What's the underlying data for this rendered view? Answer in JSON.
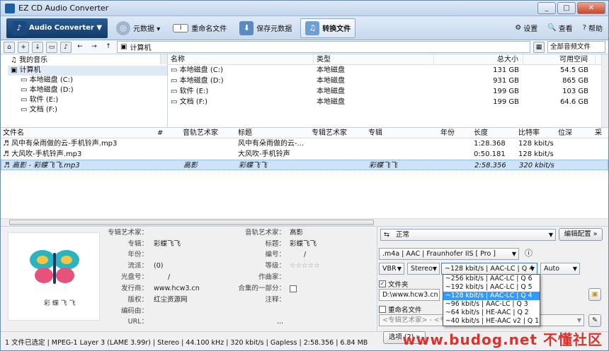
{
  "window": {
    "title": "EZ CD Audio Converter"
  },
  "ribbon": {
    "primary": "Audio Converter ▼",
    "metadata": "元数据 ▾",
    "rename": "重命名文件",
    "save_meta": "保存元数据",
    "convert": "转换文件",
    "settings": "设置",
    "view": "查看",
    "help": "帮助"
  },
  "nav": {
    "address": "计算机",
    "filter": "全部音频文件"
  },
  "tree": [
    "我的音乐",
    "计算机",
    "本地磁盘 (C:)",
    "本地磁盘 (D:)",
    "软件 (E:)",
    "文档 (F:)"
  ],
  "drives": {
    "headers": [
      "名称",
      "类型",
      "总大小",
      "可用空间"
    ],
    "rows": [
      {
        "name": "本地磁盘 (C:)",
        "type": "本地磁盘",
        "total": "131 GB",
        "free": "54.5 GB"
      },
      {
        "name": "本地磁盘 (D:)",
        "type": "本地磁盘",
        "total": "931 GB",
        "free": "865 GB"
      },
      {
        "name": "软件 (E:)",
        "type": "本地磁盘",
        "total": "199 GB",
        "free": "103 GB"
      },
      {
        "name": "文档 (F:)",
        "type": "本地磁盘",
        "total": "199 GB",
        "free": "64.6 GB"
      }
    ]
  },
  "tracks": {
    "headers": [
      "文件名",
      "#",
      "音轨艺术家",
      "标题",
      "专辑艺术家",
      "专辑",
      "年份",
      "长度",
      "比特率",
      "位深",
      "采"
    ],
    "rows": [
      {
        "file": "风中有朵雨做的云-手机铃声.mp3",
        "artist": "",
        "title": "风中有朵雨做的云-...",
        "album": "",
        "len": "1:28.368",
        "bitrate": "128 kbit/s"
      },
      {
        "file": "大风吹-手机铃声.mp3",
        "artist": "",
        "title": "大风吹-手机铃声",
        "album": "",
        "len": "0:50.181",
        "bitrate": "128 kbit/s"
      },
      {
        "file": "高影 - 彩蝶飞飞.mp3",
        "artist": "高影",
        "title": "彩蝶飞飞",
        "album": "彩蝶飞飞",
        "len": "2:58.356",
        "bitrate": "320 kbit/s"
      }
    ]
  },
  "meta": {
    "art_label": "彩 蝶 飞 飞",
    "left": [
      {
        "k": "专辑艺术家：",
        "v": ""
      },
      {
        "k": "专辑：",
        "v": "彩蝶飞飞"
      },
      {
        "k": "年份：",
        "v": ""
      },
      {
        "k": "流派：",
        "v": "(0)"
      },
      {
        "k": "光盘号：",
        "v": "/"
      },
      {
        "k": "发行商：",
        "v": "www.hcw3.cn"
      },
      {
        "k": "版权：",
        "v": "红尘资源网"
      },
      {
        "k": "编码由：",
        "v": ""
      },
      {
        "k": "URL：",
        "v": "..."
      }
    ],
    "right": [
      {
        "k": "音轨艺术家：",
        "v": "高影"
      },
      {
        "k": "标题：",
        "v": "彩蝶飞飞"
      },
      {
        "k": "编号：",
        "v": "/"
      },
      {
        "k": "等级：",
        "v": "☆☆☆☆☆"
      },
      {
        "k": "作曲家：",
        "v": ""
      },
      {
        "k": "合集的一部分：",
        "v": ""
      },
      {
        "k": "注释：",
        "v": ""
      }
    ]
  },
  "convert": {
    "profile": "正常",
    "edit_profile": "编辑配置 »",
    "format": ".m4a  |  AAC  |  Fraunhofer IIS [ Pro ]",
    "mode": "VBR",
    "channels": "Stereo",
    "quality": "~128 kbit/s | AAC-LC | Q 4",
    "rate": "Auto",
    "folder_label": "文件夹",
    "folder_path": "D:\\www.hcw3.cn",
    "rename_label": "重命名文件",
    "rename_pattern": "<专辑艺术家> - <专辑...",
    "options": "选项 (2) »",
    "dropdown": [
      "~256 kbit/s | AAC-LC | Q 6",
      "~192 kbit/s | AAC-LC | Q 5",
      "~128 kbit/s | AAC-LC | Q 4",
      "~96 kbit/s | AAC-LC | Q 3",
      "~64 kbit/s | HE-AAC | Q 2",
      "~40 kbit/s | HE-AAC v2 | Q 1"
    ]
  },
  "status": "1 文件已选定  |  MPEG-1 Layer 3 (LAME 3.99r)  |  Stereo  |  44.100 kHz  |  320 kbit/s  |  Gapless  |  2:58.356  |  6.84 MB",
  "watermark": "www.budog.net 不懂社区"
}
